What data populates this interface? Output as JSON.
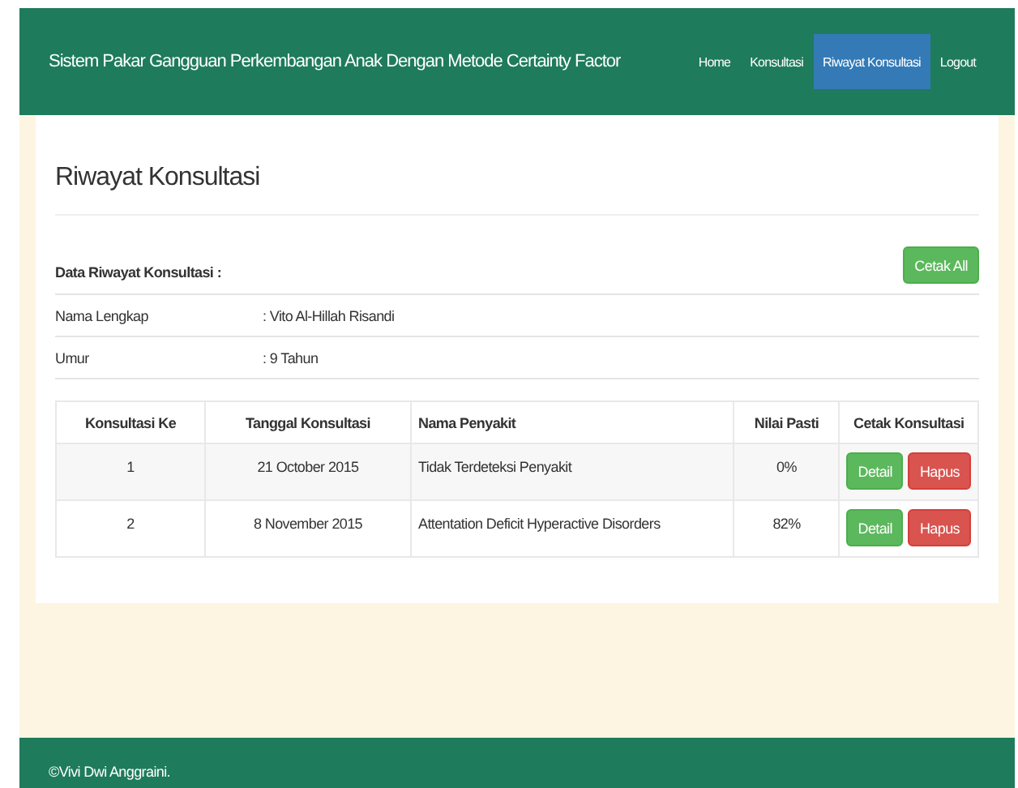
{
  "header": {
    "title": "Sistem Pakar Gangguan Perkembangan Anak Dengan Metode Certainty Factor",
    "nav": [
      {
        "label": "Home",
        "selected": false
      },
      {
        "label": "Konsultasi",
        "selected": false
      },
      {
        "label": "Riwayat Konsultasi",
        "selected": true
      },
      {
        "label": "Logout",
        "selected": false
      }
    ]
  },
  "page_title": "Riwayat Konsultasi",
  "section_title": "Data Riwayat Konsultasi :",
  "print_all_button": "Cetak All",
  "profile": [
    {
      "label": "Nama Lengkap",
      "value": ": Vito Al-Hillah Risandi"
    },
    {
      "label": "Umur",
      "value": ": 9 Tahun"
    }
  ],
  "table": {
    "columns": [
      "Konsultasi Ke",
      "Tanggal Konsultasi",
      "Nama Penyakit",
      "Nilai Pasti",
      "Cetak Konsultasi"
    ],
    "rows": [
      {
        "number": "1",
        "date": "21 October 2015",
        "disease": "Tidak Terdeteksi Penyakit",
        "certainty": "0%",
        "actions": [
          "Detail",
          "Hapus"
        ]
      },
      {
        "number": "2",
        "date": "8 November 2015",
        "disease": "Attentation Deficit Hyperactive Disorders",
        "certainty": "82%",
        "actions": [
          "Detail",
          "Hapus"
        ]
      }
    ]
  },
  "footer": "©Vivi Dwi Anggraini."
}
